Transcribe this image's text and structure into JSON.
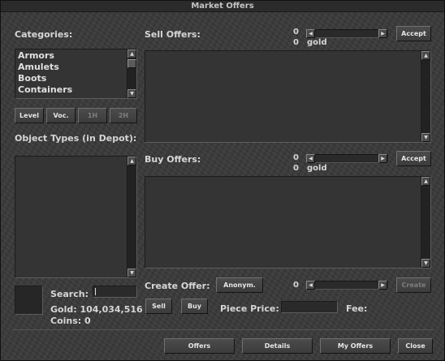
{
  "window": {
    "title": "Market Offers"
  },
  "categories": {
    "label": "Categories:",
    "items": [
      "Armors",
      "Amulets",
      "Boots",
      "Containers"
    ],
    "filters": [
      "Level",
      "Voc.",
      "1H",
      "2H"
    ]
  },
  "object_types": {
    "label": "Object Types (in Depot):"
  },
  "sell_offers": {
    "label": "Sell Offers:",
    "amount": "0",
    "gold_amount": "0",
    "gold_label": "gold",
    "accept_label": "Accept"
  },
  "buy_offers": {
    "label": "Buy Offers:",
    "amount": "0",
    "gold_amount": "0",
    "gold_label": "gold",
    "accept_label": "Accept"
  },
  "search": {
    "label": "Search:",
    "value": ""
  },
  "balance": {
    "gold": "Gold: 104,034,516",
    "coins": "Coins: 0"
  },
  "create_offer": {
    "label": "Create Offer:",
    "anonym_label": "Anonym.",
    "amount": "0",
    "create_label": "Create",
    "sell_label": "Sell",
    "buy_label": "Buy",
    "piece_price_label": "Piece Price:",
    "piece_price_value": "",
    "fee_label": "Fee:"
  },
  "footer": {
    "offers": "Offers",
    "details": "Details",
    "my_offers": "My Offers",
    "close": "Close"
  }
}
